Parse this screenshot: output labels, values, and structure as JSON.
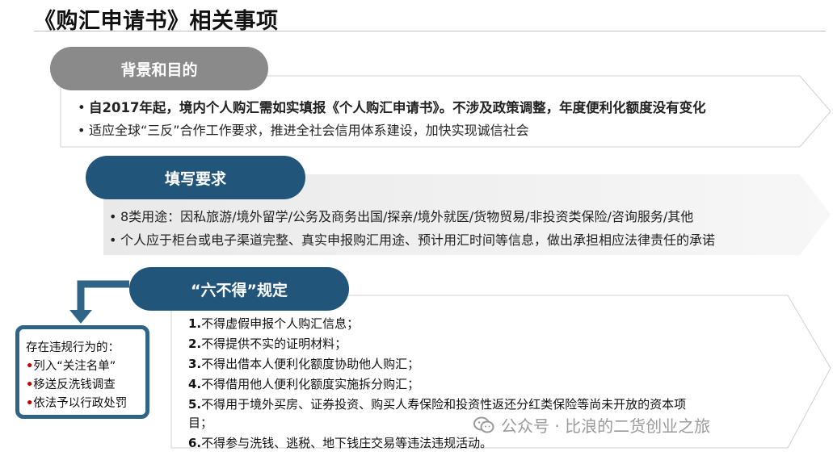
{
  "title": "《购汇申请书》相关事项",
  "section1": {
    "heading": "背景和目的",
    "items": [
      "自2017年起，境内个人购汇需如实填报《个人购汇申请书》。不涉及政策调整，年度便利化额度没有变化",
      "适应全球“三反”合作工作要求，推进全社会信用体系建设，加快实现诚信社会"
    ]
  },
  "section2": {
    "heading": "填写要求",
    "items": [
      "8类用途：因私旅游/境外留学/公务及商务出国/探亲/境外就医/货物贸易/非投资类保险/咨询服务/其他",
      "个人应于柜台或电子渠道完整、真实申报购汇用途、预计用汇时间等信息，做出承担相应法律责任的承诺"
    ]
  },
  "section3": {
    "heading": "“六不得”规定",
    "rules": [
      {
        "num": "1.",
        "text": "不得虚假申报个人购汇信息；"
      },
      {
        "num": "2.",
        "text": "不得提供不实的证明材料；"
      },
      {
        "num": "3.",
        "text": "不得出借本人便利化额度协助他人购汇；"
      },
      {
        "num": "4.",
        "text": "不得借用他人便利化额度实施拆分购汇；"
      },
      {
        "num": "5.",
        "text": "不得用于境外买房、证券投资、购买人寿保险和投资性返还分红类保险等尚未开放的资本项",
        "cont": "目；"
      },
      {
        "num": "6.",
        "text": "不得参与洗钱、逃税、地下钱庄交易等违法违规活动。"
      }
    ]
  },
  "sidebox": {
    "heading": "存在违规行为的：",
    "items": [
      "列入“关注名单”",
      "移送反洗钱调查",
      "依法予以行政处罚"
    ]
  },
  "watermark": "公众号 · 比浪的二货创业之旅",
  "colors": {
    "grey_pill": "#8a8a8a",
    "blue_pill": "#21567a",
    "box_border": "#2f6486",
    "bullet_red": "#c00000"
  },
  "icons": {
    "bullet": "•",
    "watermark": "wechat-icon",
    "arrow": "down-left-arrow-icon"
  }
}
